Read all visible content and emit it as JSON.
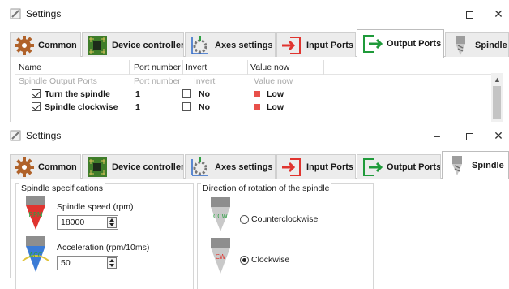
{
  "window_top": {
    "title": "Settings",
    "controls": {
      "minimize": "–",
      "maximize": "□",
      "close": "✕"
    },
    "tabs": [
      {
        "label": "Common",
        "icon": "gear-icon"
      },
      {
        "label": "Device controller",
        "icon": "circuit-board-icon"
      },
      {
        "label": "Axes settings",
        "icon": "axes-icon"
      },
      {
        "label": "Input Ports",
        "icon": "input-arrow-icon"
      },
      {
        "label": "Output Ports",
        "icon": "output-arrow-icon",
        "active": true
      },
      {
        "label": "Spindle",
        "icon": "spindle-icon"
      }
    ],
    "table": {
      "columns": [
        "Name",
        "Port number",
        "Invert",
        "Value now"
      ],
      "group_row": {
        "name": "Spindle Output Ports",
        "port": "Port number",
        "invert": "Invert",
        "value": "Value now"
      },
      "rows": [
        {
          "name": "Turn the spindle",
          "enabled": true,
          "port": "1",
          "invert": "No",
          "value": "Low"
        },
        {
          "name": "Spindle clockwise",
          "enabled": true,
          "port": "1",
          "invert": "No",
          "value": "Low"
        }
      ]
    }
  },
  "window_bottom": {
    "title": "Settings",
    "controls": {
      "minimize": "–",
      "maximize": "□",
      "close": "✕"
    },
    "tabs": [
      {
        "label": "Common",
        "icon": "gear-icon"
      },
      {
        "label": "Device controller",
        "icon": "circuit-board-icon"
      },
      {
        "label": "Axes settings",
        "icon": "axes-icon"
      },
      {
        "label": "Input Ports",
        "icon": "input-arrow-icon"
      },
      {
        "label": "Output Ports",
        "icon": "output-arrow-icon"
      },
      {
        "label": "Spindle",
        "icon": "spindle-icon",
        "active": true
      }
    ],
    "spindle_specs": {
      "title": "Spindle specifications",
      "speed_label": "Spindle speed (rpm)",
      "speed_value": "18000",
      "speed_icon_text": "RPM",
      "accel_label": "Acceleration (rpm/10ms)",
      "accel_value": "50",
      "accel_icon_text": "ACC"
    },
    "rotation": {
      "title": "Direction of rotation of the spindle",
      "ccw_label": "Counterclockwise",
      "ccw_icon_text": "CCW",
      "cw_label": "Clockwise",
      "cw_icon_text": "CW",
      "selected": "Clockwise"
    }
  },
  "colors": {
    "input_arrow": "#e0342f",
    "output_arrow": "#1f9a3a",
    "gear": "#b0622a",
    "board": "#3f7d2a",
    "led_low": "#e8504a"
  }
}
